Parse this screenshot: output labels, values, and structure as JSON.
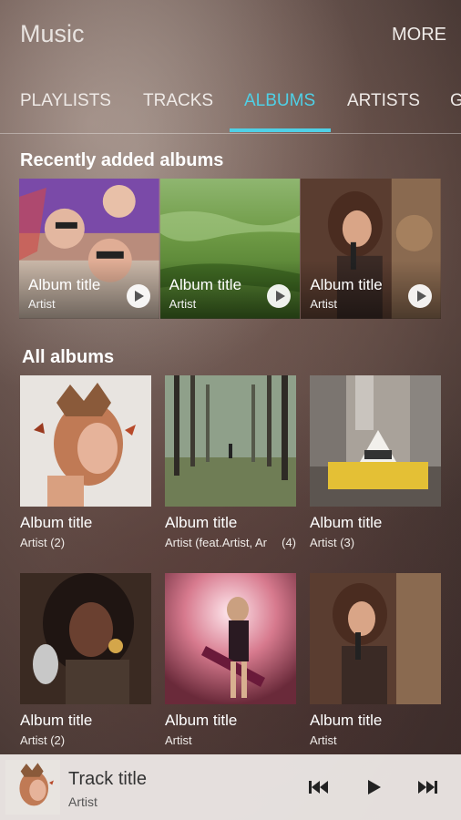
{
  "app": {
    "title": "Music",
    "more_label": "MORE"
  },
  "tabs": [
    {
      "label": "PLAYLISTS",
      "active": false
    },
    {
      "label": "TRACKS",
      "active": false
    },
    {
      "label": "ALBUMS",
      "active": true
    },
    {
      "label": "ARTISTS",
      "active": false
    },
    {
      "label": "G",
      "active": false
    }
  ],
  "accent_color": "#4fd0e6",
  "recent": {
    "heading": "Recently added albums",
    "items": [
      {
        "title": "Album title",
        "artist": "Artist",
        "art": "girls-lying-on-blanket-photo"
      },
      {
        "title": "Album title",
        "artist": "Artist",
        "art": "green-grass-field-photo"
      },
      {
        "title": "Album title",
        "artist": "Artist",
        "art": "woman-singing-microphone-photo"
      }
    ]
  },
  "all": {
    "heading": "All albums",
    "items": [
      {
        "title": "Album title",
        "artist": "Artist (2)",
        "art": "woman-crown-butterflies-photo"
      },
      {
        "title": "Album title",
        "artist": "Artist (feat.Artist, Ar",
        "count": "(4)",
        "art": "misty-forest-path-photo"
      },
      {
        "title": "Album title",
        "artist": "Artist (3)",
        "art": "taxi-city-street-photo"
      },
      {
        "title": "Album title",
        "artist": "Artist (2)",
        "art": "woman-vintage-mic-photo"
      },
      {
        "title": "Album title",
        "artist": "Artist",
        "art": "guitarist-stage-lights-photo"
      },
      {
        "title": "Album title",
        "artist": "Artist",
        "art": "woman-singing-microphone-photo"
      }
    ]
  },
  "mini_player": {
    "track_title": "Track title",
    "artist": "Artist",
    "art": "woman-crown-butterflies-photo",
    "controls": [
      "previous-icon",
      "play-icon",
      "next-icon"
    ]
  }
}
